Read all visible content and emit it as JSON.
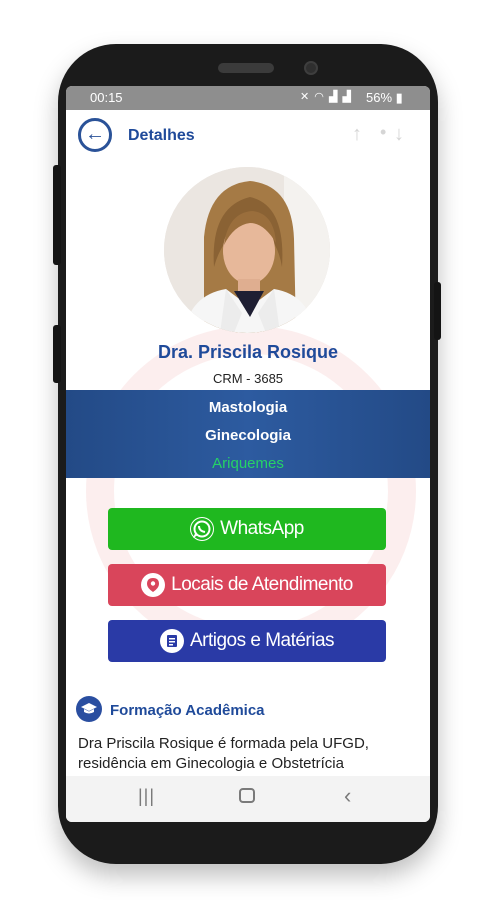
{
  "status_bar": {
    "time": "00:15",
    "battery": "56%",
    "icons": [
      "mute-icon",
      "wifi-icon",
      "signal-icon",
      "signal-icon",
      "battery-icon"
    ]
  },
  "app_bar": {
    "title": "Detalhes",
    "back_icon": "back-arrow-icon",
    "prev_icon": "arrow-up-icon",
    "next_icon": "arrow-down-icon"
  },
  "doctor": {
    "name": "Dra. Priscila Rosique",
    "crm": "CRM - 3685",
    "specialties": [
      "Mastologia",
      "Ginecologia"
    ],
    "city": "Ariquemes"
  },
  "actions": {
    "whatsapp_label": "WhatsApp",
    "locais_label": "Locais de Atendimento",
    "artigos_label": "Artigos e Matérias"
  },
  "formacao": {
    "title": "Formação Acadêmica",
    "text": "Dra Priscila Rosique é formada pela UFGD, residência em Ginecologia e Obstetrícia"
  },
  "colors": {
    "primary": "#1f4a9a",
    "band": "#2d5ba0",
    "whatsapp": "#1fb81f",
    "locais": "#d9455b",
    "artigos": "#2a3aa6",
    "city": "#25d366"
  }
}
